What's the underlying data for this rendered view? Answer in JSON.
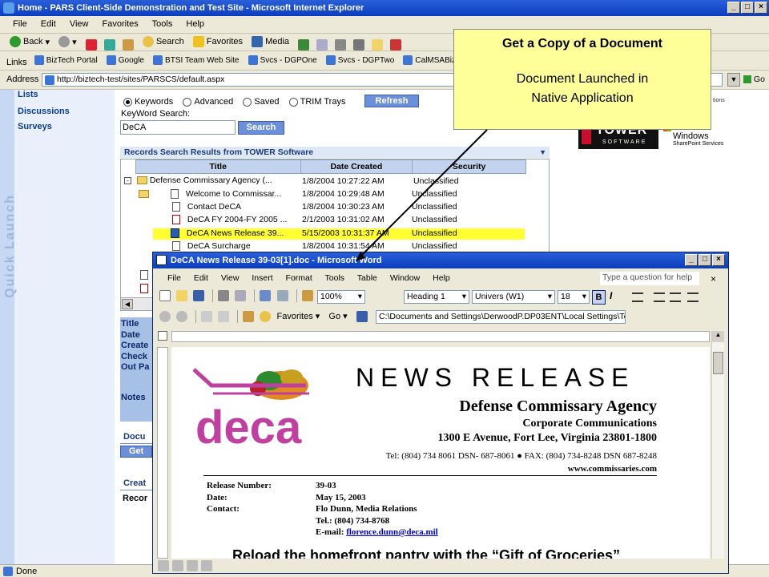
{
  "ie": {
    "title": "Home - PARS Client-Side Demonstration and Test Site - Microsoft Internet Explorer",
    "menu": [
      "File",
      "Edit",
      "View",
      "Favorites",
      "Tools",
      "Help"
    ],
    "toolbar": {
      "back": "Back",
      "search": "Search",
      "favorites": "Favorites",
      "media": "Media"
    },
    "links_label": "Links",
    "links": [
      "BizTech Portal",
      "Google",
      "BTSI Team Web Site",
      "Svcs - DGPOne",
      "Svcs - DGPTwo",
      "CalMSABiz"
    ],
    "address_label": "Address",
    "address": "http://biztech-test/sites/PARSCS/default.aspx",
    "go": "Go",
    "status": "Done"
  },
  "leftnav": {
    "quick_launch": "Quick Launch",
    "items": [
      "Lists",
      "Discussions",
      "Surveys"
    ]
  },
  "search": {
    "options": [
      "Keywords",
      "Advanced",
      "Saved",
      "TRIM Trays"
    ],
    "refresh": "Refresh",
    "label": "KeyWord Search:",
    "value": "DeCA",
    "button": "Search"
  },
  "results": {
    "header": "Records Search Results from TOWER Software",
    "columns": [
      "Title",
      "Date Created",
      "Security"
    ],
    "rows": [
      {
        "title": "Defense Commissary Agency (...",
        "date": "1/8/2004 10:27:22 AM",
        "security": "Unclassified"
      },
      {
        "title": "Welcome to Commissar...",
        "date": "1/8/2004 10:29:48 AM",
        "security": "Unclassified"
      },
      {
        "title": "Contact DeCA",
        "date": "1/8/2004 10:30:23 AM",
        "security": "Unclassified"
      },
      {
        "title": "DeCA FY 2004-FY 2005 ...",
        "date": "2/1/2003 10:31:02 AM",
        "security": "Unclassified"
      },
      {
        "title": "DeCA News Release 39...",
        "date": "5/15/2003 10:31:37 AM",
        "security": "Unclassified"
      },
      {
        "title": "DeCA Surcharge",
        "date": "1/8/2004 10:31:54 AM",
        "security": "Unclassified"
      }
    ]
  },
  "props": {
    "labels": [
      "Title",
      "Date",
      "Create",
      "Check",
      "Out Pa"
    ],
    "notes": "Notes"
  },
  "doc_panel": {
    "header": "Docu",
    "button": "Get"
  },
  "create_panel": {
    "header": "Creat",
    "label": "Recor"
  },
  "tower_logo": {
    "tower": "TOWER",
    "software": "SOFTWARE",
    "windows": "Windows",
    "sps": "SharePoint Services",
    "tions": "tions"
  },
  "callout": {
    "title": "Get a Copy of a Document",
    "line1": "Document Launched in",
    "line2": "Native Application"
  },
  "word": {
    "title": "DeCA News Release 39-03[1].doc - Microsoft Word",
    "menu": [
      "File",
      "Edit",
      "View",
      "Insert",
      "Format",
      "Tools",
      "Table",
      "Window",
      "Help"
    ],
    "ask": "Type a question for help",
    "zoom": "100%",
    "style": "Heading 1",
    "font": "Univers (W1)",
    "size": "18",
    "favorites": "Favorites",
    "go": "Go",
    "path": "C:\\Documents and Settings\\DerwoodP.DP03ENT\\Local Settings\\Te"
  },
  "release": {
    "logo": "deca",
    "heading": "NEWS RELEASE",
    "agency": "Defense Commissary Agency",
    "dept": "Corporate Communications",
    "address": "1300 E Avenue, Fort Lee, Virginia 23801-1800",
    "tel": "Tel:  (804) 734 8061  DSN- 687-8061  ●  FAX: (804) 734-8248  DSN 687-8248",
    "web": "www.commissaries.com",
    "fields": [
      {
        "label": "Release Number:",
        "value": "39-03"
      },
      {
        "label": "Date:",
        "value": "May 15, 2003"
      },
      {
        "label": "Contact:",
        "value": "Flo Dunn, Media Relations"
      },
      {
        "label": "",
        "value": "Tel.:  (804) 734-8768"
      }
    ],
    "email_label": "E-mail:",
    "email": "florence.dunn@deca.mil",
    "headline": "Reload the homefront pantry with the “Gift of Groceries”"
  }
}
